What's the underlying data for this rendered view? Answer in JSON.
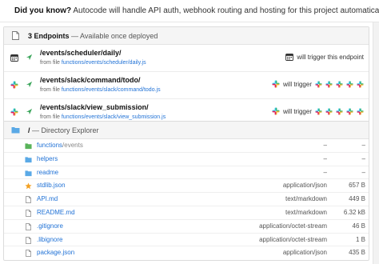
{
  "notice": {
    "lead": "Did you know?",
    "text": "Autocode will handle API auth, webhook routing and hosting for this project automatically."
  },
  "endpoints": {
    "count_label": "3 Endpoints",
    "subtitle": "— Available once deployed",
    "items": [
      {
        "source": "calendar",
        "path": "/events/scheduler/daily/",
        "from_prefix": "from file",
        "file": "functions/events/scheduler/daily.js",
        "trigger_text": "will trigger this endpoint",
        "trigger_icon": "calendar-icon"
      },
      {
        "source": "slack",
        "path": "/events/slack/command/todo/",
        "from_prefix": "from file",
        "file": "functions/events/slack/command/todo.js",
        "trigger_text": "will trigger",
        "trigger_icon": "slack-icon"
      },
      {
        "source": "slack",
        "path": "/events/slack/view_submission/",
        "from_prefix": "from file",
        "file": "functions/events/slack/view_submission.js",
        "trigger_text": "will trigger",
        "trigger_icon": "slack-icon"
      }
    ]
  },
  "directory": {
    "path": "/",
    "subtitle": "— Directory Explorer",
    "items": [
      {
        "name": "functions",
        "sub": "/events",
        "type": "–",
        "size": "–",
        "icon": "folder-green"
      },
      {
        "name": "helpers",
        "sub": "",
        "type": "–",
        "size": "–",
        "icon": "folder-blue"
      },
      {
        "name": "readme",
        "sub": "",
        "type": "–",
        "size": "–",
        "icon": "folder-blue"
      },
      {
        "name": "stdlib.json",
        "sub": "",
        "type": "application/json",
        "size": "657 B",
        "icon": "star"
      },
      {
        "name": "API.md",
        "sub": "",
        "type": "text/markdown",
        "size": "449 B",
        "icon": "file"
      },
      {
        "name": "README.md",
        "sub": "",
        "type": "text/markdown",
        "size": "6.32 kB",
        "icon": "file"
      },
      {
        "name": ".gitignore",
        "sub": "",
        "type": "application/octet-stream",
        "size": "46 B",
        "icon": "file"
      },
      {
        "name": ".libignore",
        "sub": "",
        "type": "application/octet-stream",
        "size": "1 B",
        "icon": "file"
      },
      {
        "name": "package.json",
        "sub": "",
        "type": "application/json",
        "size": "435 B",
        "icon": "file"
      }
    ]
  },
  "colors": {
    "link": "#2273d6",
    "flame": "#f08a24",
    "folder_green": "#59b35a",
    "folder_blue": "#5aa9e6",
    "star": "#f3a021",
    "arrow": "#3aa55a"
  }
}
